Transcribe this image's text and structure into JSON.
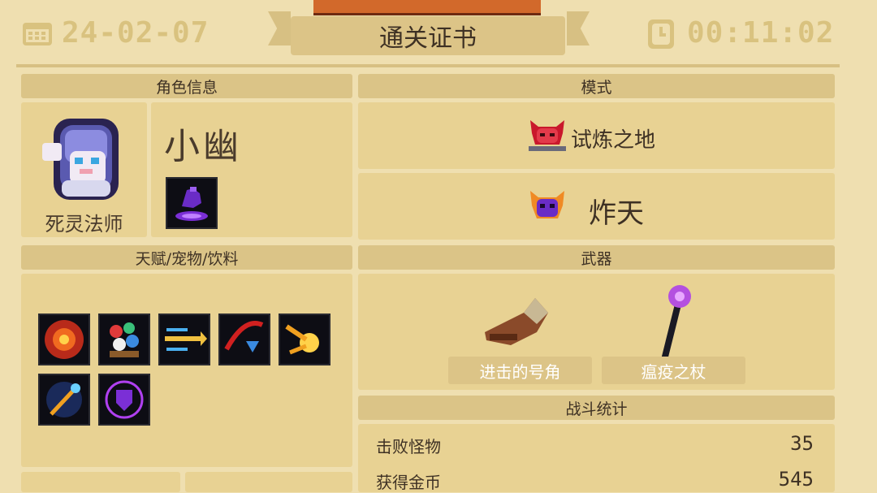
{
  "header": {
    "date": "24-02-07",
    "banner": "通关证书",
    "time": "00:11:02"
  },
  "character": {
    "section": "角色信息",
    "name": "小幽",
    "class": "死灵法师"
  },
  "mode": {
    "section": "模式",
    "level": "试炼之地",
    "difficulty": "炸天"
  },
  "talents": {
    "section": "天赋/宠物/饮料"
  },
  "weapons": {
    "section": "武器",
    "items": [
      "进击的号角",
      "瘟疫之杖"
    ]
  },
  "stats": {
    "section": "战斗统计",
    "rows": [
      {
        "label": "击败怪物",
        "value": "35"
      },
      {
        "label": "获得金币",
        "value": "545"
      }
    ]
  },
  "colors": {
    "background": "#efdfb0",
    "panel": "#e8d293",
    "band": "#dbc487",
    "accent_purple": "#7b2fd6"
  }
}
